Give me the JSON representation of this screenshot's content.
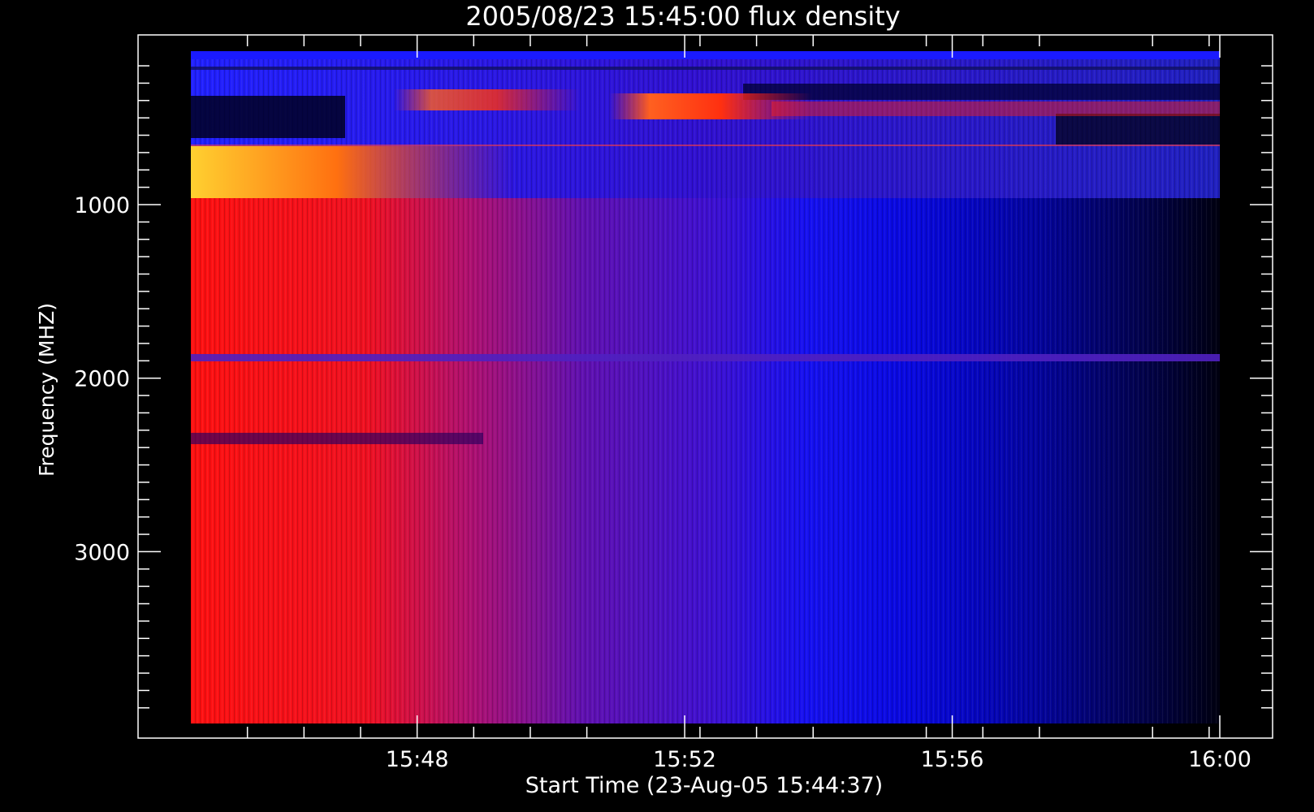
{
  "chart_data": {
    "type": "heatmap",
    "title": "2005/08/23 15:45:00 flux density",
    "xlabel": "Start Time (23-Aug-05 15:44:37)",
    "ylabel": "Frequency (MHZ)",
    "x_ticks": [
      {
        "value": 3.383,
        "label": "15:48"
      },
      {
        "value": 7.383,
        "label": "15:52"
      },
      {
        "value": 11.383,
        "label": "15:56"
      },
      {
        "value": 15.383,
        "label": "16:00"
      }
    ],
    "y_ticks": [
      {
        "value": 1000,
        "label": "1000"
      },
      {
        "value": 2000,
        "label": "2000"
      },
      {
        "value": 3000,
        "label": "3000"
      }
    ],
    "xlim_minutes_after_start": [
      0,
      15.383
    ],
    "ylim_mhz": [
      100,
      3980
    ],
    "y_axis_inverted": true,
    "grid": false,
    "colormap": [
      "#000000",
      "#0000ff",
      "#ff0000",
      "#ffff00",
      "#ffffff"
    ],
    "features": [
      {
        "name": "broadband emission",
        "time_range": [
          "15:44:37",
          "15:49:00"
        ],
        "freq_range_mhz": [
          1000,
          3980
        ],
        "intensity": "high"
      },
      {
        "name": "decay",
        "time_range": [
          "15:49:00",
          "15:54:00"
        ],
        "freq_range_mhz": [
          1000,
          3980
        ],
        "intensity": "medium"
      },
      {
        "name": "low-frequency burst",
        "time_range": [
          "15:44:37",
          "15:48:30"
        ],
        "freq_range_mhz": [
          650,
          950
        ],
        "intensity": "very high"
      },
      {
        "name": "drifting lane",
        "time_range": [
          "15:51:30",
          "15:58:00"
        ],
        "freq_range_mhz": [
          350,
          500
        ],
        "intensity": "high"
      },
      {
        "name": "interference line",
        "time_range": [
          "15:44:37",
          "16:00:00"
        ],
        "freq_range_mhz": [
          1870,
          1900
        ],
        "intensity": "medium"
      }
    ]
  }
}
